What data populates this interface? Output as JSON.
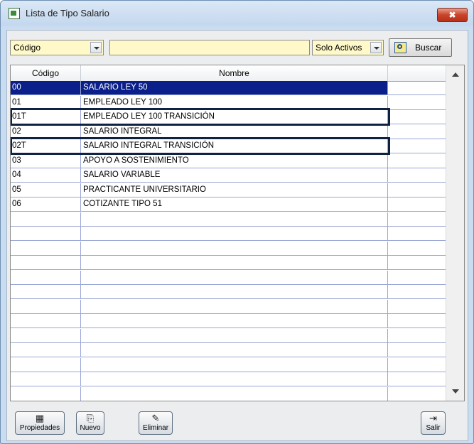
{
  "window": {
    "title": "Lista de Tipo Salario",
    "close_label": "✖"
  },
  "toolbar": {
    "field_selector": "Código",
    "search_value": "",
    "filter_selector": "Solo Activos",
    "search_button": "Buscar"
  },
  "table": {
    "columns": [
      "Código",
      "Nombre",
      ""
    ],
    "rows": [
      {
        "code": "00",
        "name": "SALARIO LEY 50"
      },
      {
        "code": "01",
        "name": "EMPLEADO LEY 100"
      },
      {
        "code": "01T",
        "name": "EMPLEADO LEY 100 TRANSICIÓN"
      },
      {
        "code": "02",
        "name": "SALARIO INTEGRAL"
      },
      {
        "code": "02T",
        "name": "SALARIO INTEGRAL TRANSICIÓN"
      },
      {
        "code": "03",
        "name": "APOYO A SOSTENIMIENTO"
      },
      {
        "code": "04",
        "name": "SALARIO VARIABLE"
      },
      {
        "code": "05",
        "name": "PRACTICANTE UNIVERSITARIO"
      },
      {
        "code": "06",
        "name": "COTIZANTE TIPO 51"
      }
    ],
    "selected_row": 0,
    "highlighted_rows": [
      2,
      4
    ],
    "empty_rows": 13
  },
  "footer": {
    "properties_label": "Propiedades",
    "new_label": "Nuevo",
    "delete_label": "Eliminar",
    "exit_label": "Salir"
  },
  "icons": {
    "app": "app-icon",
    "search": "search-icon",
    "properties": "properties-icon",
    "new": "new-document-icon",
    "delete": "eraser-icon",
    "exit": "exit-door-icon"
  }
}
